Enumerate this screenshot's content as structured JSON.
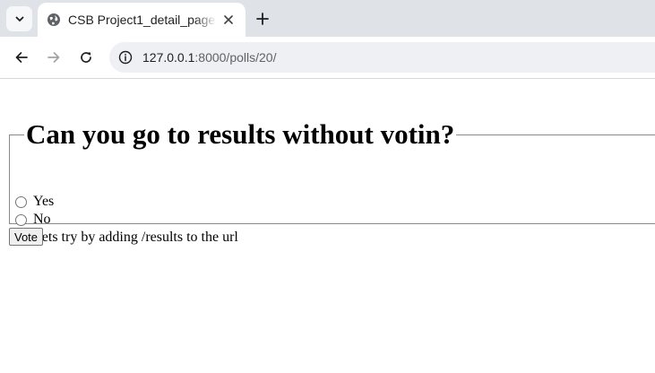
{
  "browser": {
    "tab": {
      "title": "CSB Project1_detail_page"
    },
    "address_bar": {
      "host": "127.0.0.1",
      "path": ":8000/polls/20/"
    }
  },
  "poll": {
    "question": "Can you go to results without votin?",
    "choices": [
      {
        "label": "Yes"
      },
      {
        "label": "No"
      },
      {
        "label": "Lets try by adding /results to the url"
      }
    ],
    "vote_label": "Vote"
  }
}
